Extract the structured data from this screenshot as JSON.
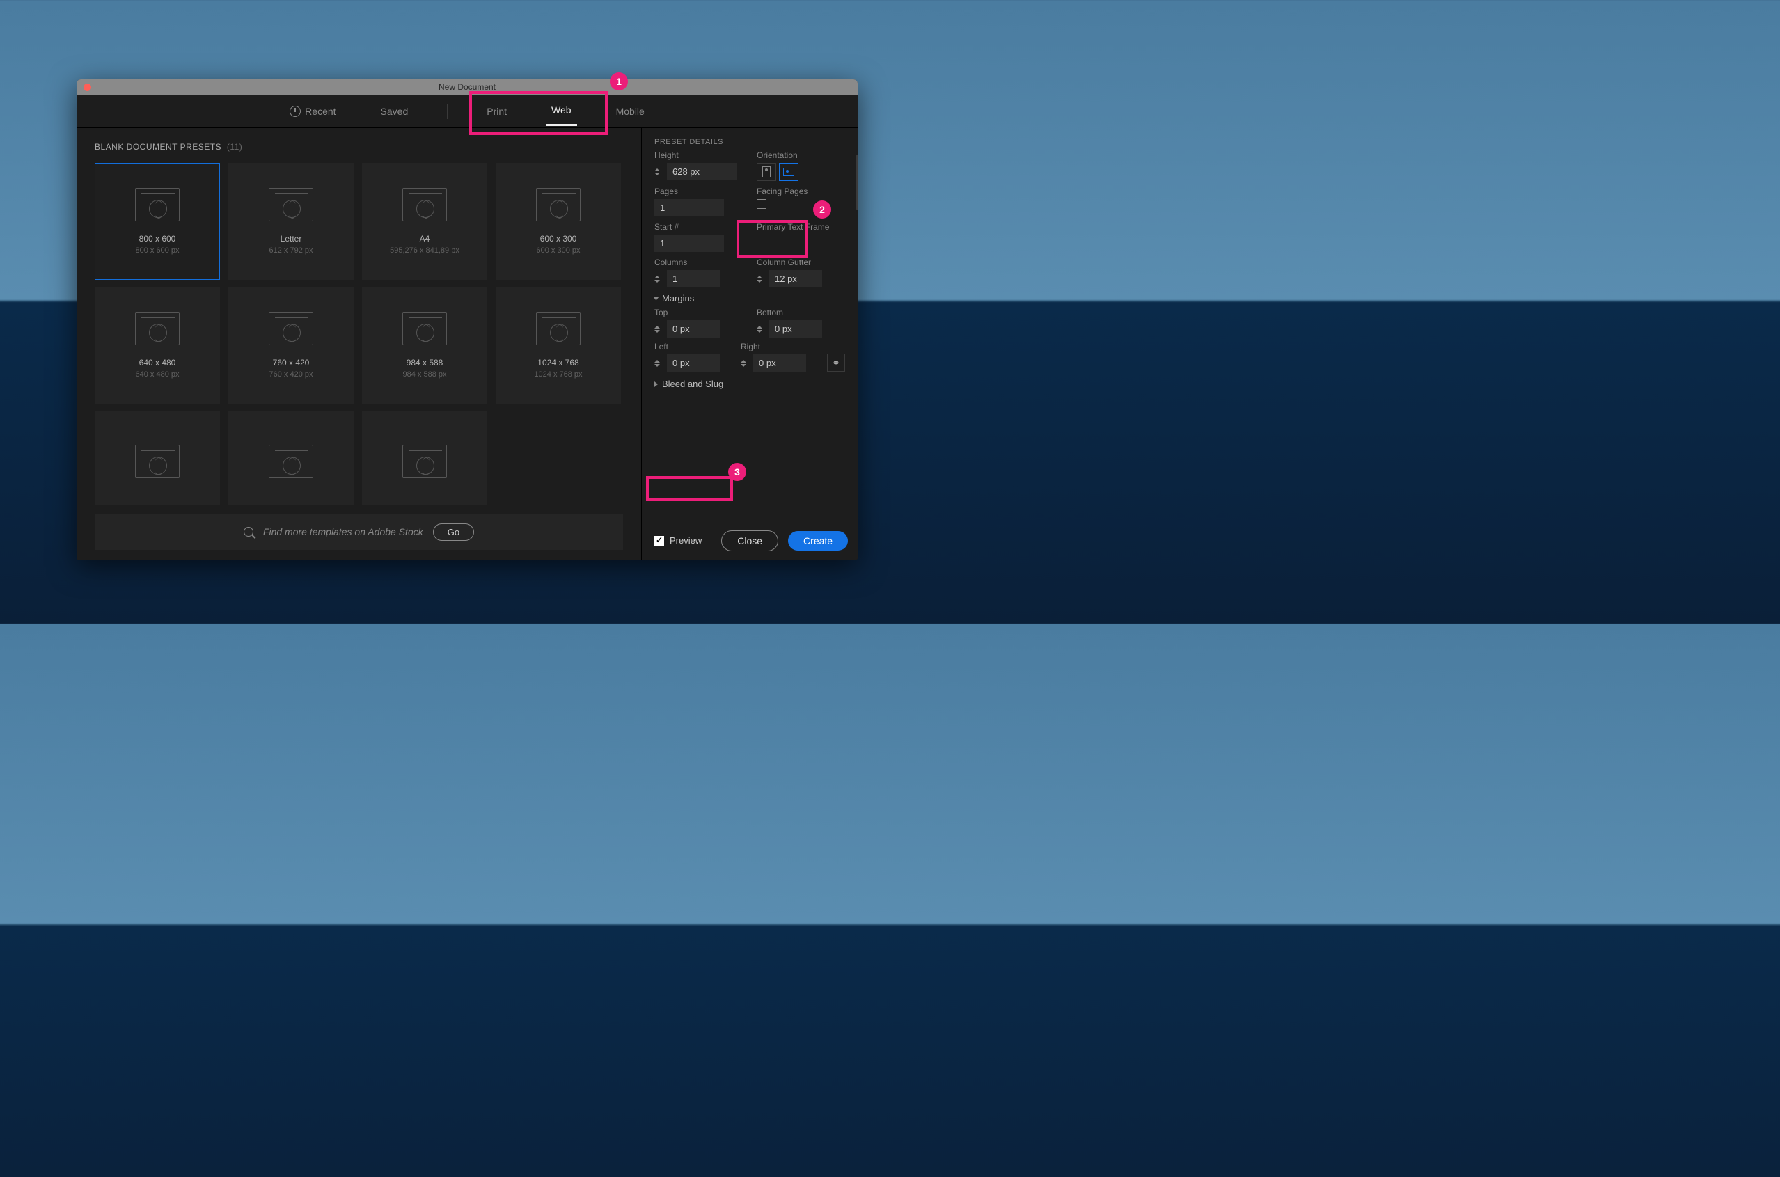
{
  "dialog": {
    "title": "New Document",
    "tabs": {
      "recent": "Recent",
      "saved": "Saved",
      "print": "Print",
      "web": "Web",
      "mobile": "Mobile"
    }
  },
  "presets": {
    "header": "BLANK DOCUMENT PRESETS",
    "count": "(11)",
    "items": [
      {
        "name": "800 x 600",
        "dim": "800 x 600 px",
        "selected": true
      },
      {
        "name": "Letter",
        "dim": "612 x 792 px"
      },
      {
        "name": "A4",
        "dim": "595,276 x 841,89 px"
      },
      {
        "name": "600 x 300",
        "dim": "600 x 300 px"
      },
      {
        "name": "640 x 480",
        "dim": "640 x 480 px"
      },
      {
        "name": "760 x 420",
        "dim": "760 x 420 px"
      },
      {
        "name": "984 x 588",
        "dim": "984 x 588 px"
      },
      {
        "name": "1024 x 768",
        "dim": "1024 x 768 px"
      },
      {
        "name": "",
        "dim": ""
      },
      {
        "name": "",
        "dim": ""
      },
      {
        "name": "",
        "dim": ""
      }
    ],
    "search_placeholder": "Find more templates on Adobe Stock",
    "go": "Go"
  },
  "details": {
    "header": "PRESET DETAILS",
    "height_label": "Height",
    "height_value": "628 px",
    "orientation_label": "Orientation",
    "pages_label": "Pages",
    "pages_value": "1",
    "facing_label": "Facing Pages",
    "start_label": "Start #",
    "start_value": "1",
    "ptf_label": "Primary Text Frame",
    "columns_label": "Columns",
    "columns_value": "1",
    "gutter_label": "Column Gutter",
    "gutter_value": "12 px",
    "margins_label": "Margins",
    "top_label": "Top",
    "top_value": "0 px",
    "bottom_label": "Bottom",
    "bottom_value": "0 px",
    "left_label": "Left",
    "left_value": "0 px",
    "right_label": "Right",
    "right_value": "0 px",
    "bleed_label": "Bleed and Slug"
  },
  "footer": {
    "preview": "Preview",
    "close": "Close",
    "create": "Create"
  },
  "annotations": {
    "n1": "1",
    "n2": "2",
    "n3": "3"
  }
}
